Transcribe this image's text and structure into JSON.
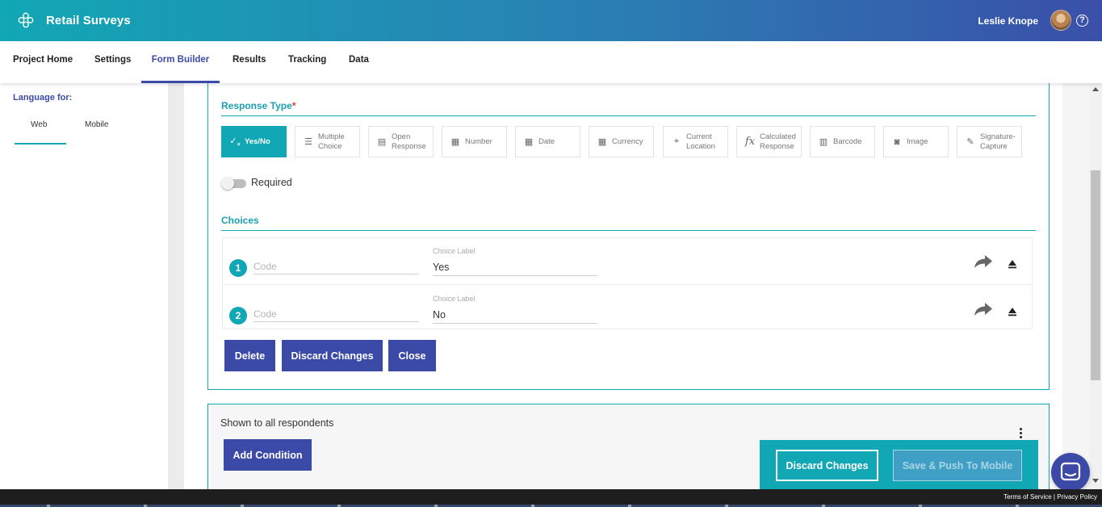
{
  "header": {
    "app_title": "Retail Surveys",
    "user_name": "Leslie Knope",
    "help_glyph": "?",
    "colors": {
      "teal": "#12a7b5",
      "indigo": "#3b4aa6"
    }
  },
  "nav": {
    "tabs": [
      {
        "label": "Project Home",
        "active": false
      },
      {
        "label": "Settings",
        "active": false
      },
      {
        "label": "Form Builder",
        "active": true
      },
      {
        "label": "Results",
        "active": false
      },
      {
        "label": "Tracking",
        "active": false
      },
      {
        "label": "Data",
        "active": false
      }
    ]
  },
  "sidebar": {
    "language_label": "Language for:",
    "tabs": [
      {
        "label": "Web",
        "active": true
      },
      {
        "label": "Mobile",
        "active": false
      }
    ]
  },
  "editor": {
    "response_type_title": "Response Type",
    "required_mark": "*",
    "response_types": [
      {
        "label": "Yes/No",
        "icon": "check-x-icon",
        "active": true
      },
      {
        "label": "Multiple Choice",
        "icon": "list-icon",
        "active": false
      },
      {
        "label": "Open Response",
        "icon": "text-box-icon",
        "active": false
      },
      {
        "label": "Number",
        "icon": "number-grid-icon",
        "active": false
      },
      {
        "label": "Date",
        "icon": "calendar-icon",
        "active": false
      },
      {
        "label": "Currency",
        "icon": "currency-grid-icon",
        "active": false
      },
      {
        "label": "Current Location",
        "icon": "location-pin-icon",
        "active": false
      },
      {
        "label": "Calculated Response",
        "icon": "function-icon",
        "active": false
      },
      {
        "label": "Barcode",
        "icon": "barcode-icon",
        "active": false
      },
      {
        "label": "Image",
        "icon": "camera-icon",
        "active": false
      },
      {
        "label": "Signature-Capture",
        "icon": "pen-icon",
        "active": false
      }
    ],
    "required_label": "Required",
    "required_on": false,
    "choices_title": "Choices",
    "choices": [
      {
        "number": "1",
        "code_placeholder": "Code",
        "code_value": "",
        "label_caption": "Choice Label",
        "label_value": "Yes"
      },
      {
        "number": "2",
        "code_placeholder": "Code",
        "code_value": "",
        "label_caption": "Choice Label",
        "label_value": "No"
      }
    ],
    "buttons": {
      "delete": "Delete",
      "discard": "Discard Changes",
      "close": "Close"
    }
  },
  "condition": {
    "text": "Shown to all respondents",
    "add_button": "Add Condition"
  },
  "action_bar": {
    "discard": "Discard Changes",
    "save": "Save & Push To Mobile"
  },
  "footer": {
    "terms": "Terms of Service",
    "separator": " | ",
    "privacy": "Privacy Policy"
  }
}
